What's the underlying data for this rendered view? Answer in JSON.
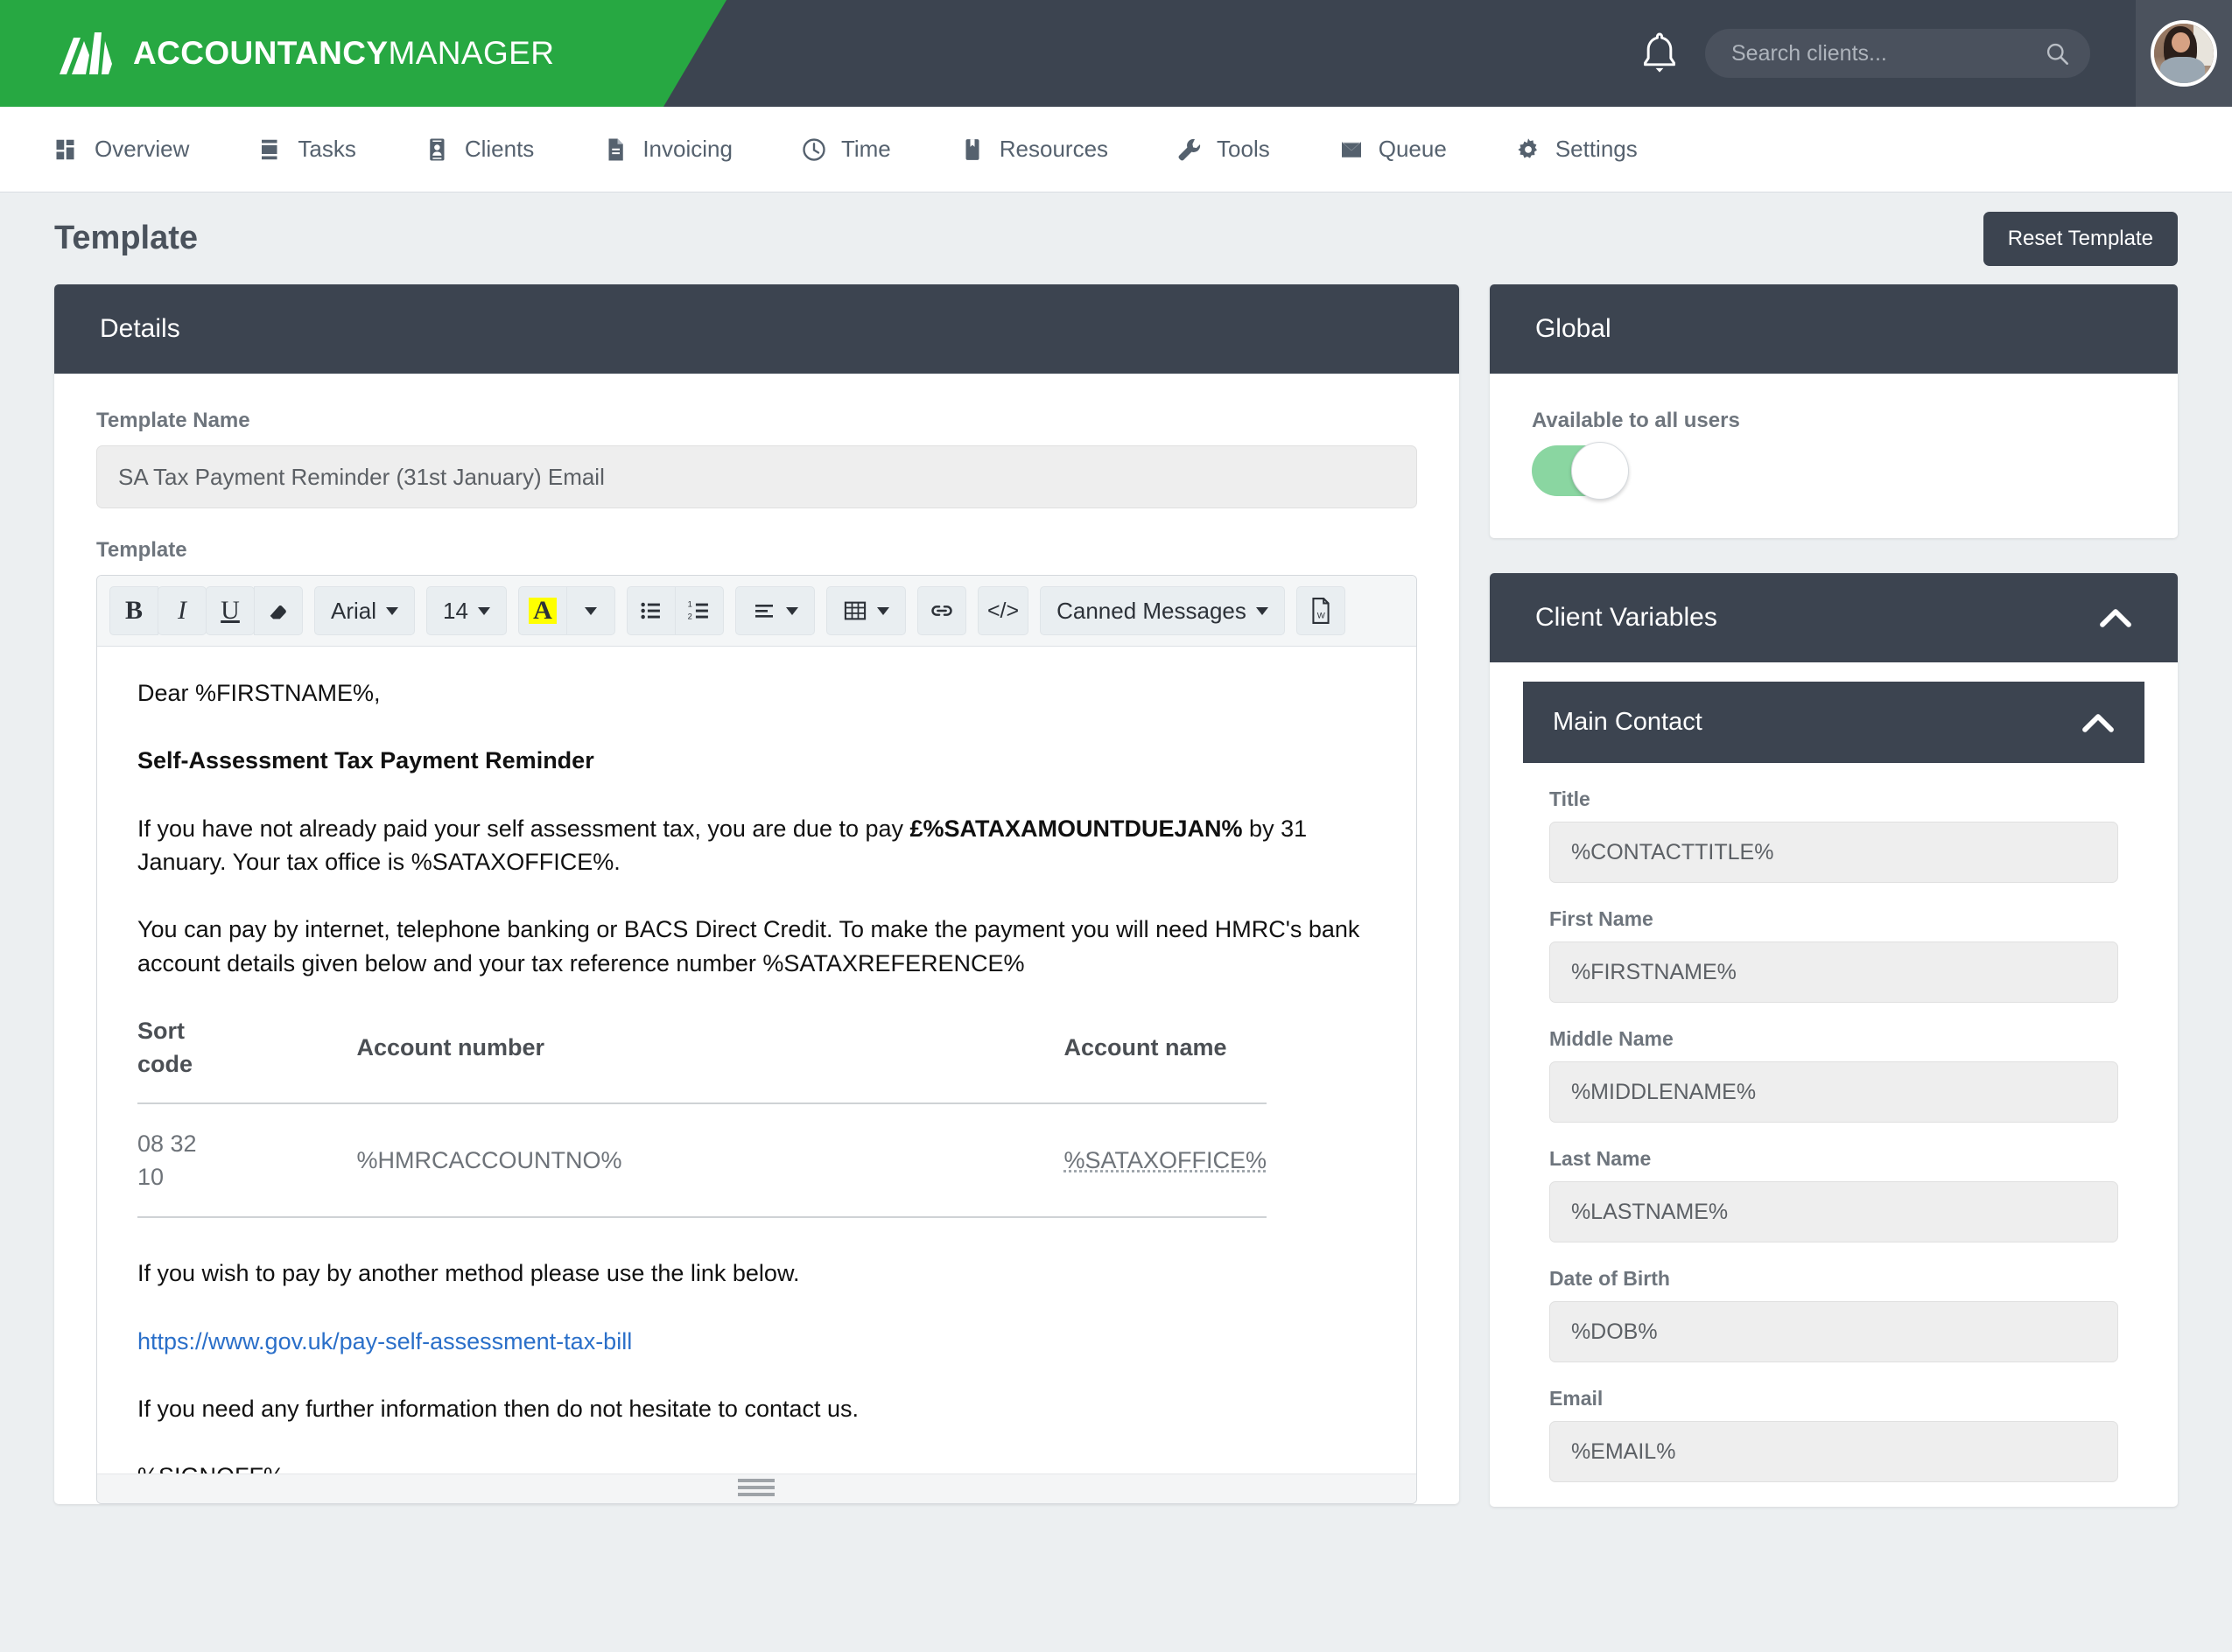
{
  "brand": {
    "name_bold": "ACCOUNTANCY",
    "name_light": "MANAGER",
    "green": "#27a842",
    "dark": "#3c4450"
  },
  "header": {
    "search_placeholder": "Search clients...",
    "search_value": "",
    "bell_icon": "bell-icon",
    "avatar_icon": "avatar"
  },
  "nav": {
    "items": [
      {
        "label": "Overview",
        "icon": "dashboard-grid-icon"
      },
      {
        "label": "Tasks",
        "icon": "list-icon"
      },
      {
        "label": "Clients",
        "icon": "contact-card-icon"
      },
      {
        "label": "Invoicing",
        "icon": "document-icon"
      },
      {
        "label": "Time",
        "icon": "clock-icon"
      },
      {
        "label": "Resources",
        "icon": "book-icon"
      },
      {
        "label": "Tools",
        "icon": "wrench-icon"
      },
      {
        "label": "Queue",
        "icon": "envelope-icon"
      },
      {
        "label": "Settings",
        "icon": "gear-icon"
      }
    ]
  },
  "page": {
    "title": "Template",
    "reset_button": "Reset Template"
  },
  "details": {
    "card_title": "Details",
    "template_name_label": "Template Name",
    "template_name_value": "SA Tax Payment Reminder (31st January) Email",
    "template_label": "Template"
  },
  "toolbar": {
    "bold": "B",
    "italic": "I",
    "underline": "U",
    "eraser_icon": "eraser-icon",
    "font_family": "Arial",
    "font_size": "14",
    "highlight_letter": "A",
    "bullet_list_icon": "bullet-list-icon",
    "numbered_list_icon": "numbered-list-icon",
    "align_icon": "align-left-icon",
    "table_icon": "table-icon",
    "link_icon": "link-icon",
    "code_label": "</>",
    "canned_messages": "Canned Messages",
    "word_icon": "word-document-icon"
  },
  "editor": {
    "greeting": "Dear %FIRSTNAME%,",
    "subject": "Self-Assessment Tax Payment Reminder",
    "para1_a": "If you have not already paid your self assessment tax, you are due to pay ",
    "para1_bold": "£%SATAXAMOUNTDUEJAN%",
    "para1_b": " by 31 January. Your tax office is %SATAXOFFICE%.",
    "para2": "You can pay by internet, telephone banking or BACS Direct Credit. To make the payment you will need HMRC's bank account details given below and your tax reference number %SATAXREFERENCE%",
    "table": {
      "headers": [
        "Sort code",
        "Account number",
        "Account name"
      ],
      "rows": [
        [
          "08 32 10",
          "%HMRCACCOUNTNO%",
          "%SATAXOFFICE%"
        ]
      ]
    },
    "para3": "If you wish to pay by another method please use the link below.",
    "link": "https://www.gov.uk/pay-self-assessment-tax-bill",
    "para4": "If you need any further information then do not hesitate to contact us.",
    "signoff": "%SIGNOFF%"
  },
  "global": {
    "card_title": "Global",
    "available_label": "Available to all users",
    "available_on": true,
    "toggle_color": "#8ad6a1"
  },
  "client_variables": {
    "card_title": "Client Variables",
    "collapse_icon": "chevron-up-icon",
    "main_contact": {
      "title": "Main Contact",
      "collapse_icon": "chevron-up-icon",
      "fields": [
        {
          "label": "Title",
          "value": "%CONTACTTITLE%"
        },
        {
          "label": "First Name",
          "value": "%FIRSTNAME%"
        },
        {
          "label": "Middle Name",
          "value": "%MIDDLENAME%"
        },
        {
          "label": "Last Name",
          "value": "%LASTNAME%"
        },
        {
          "label": "Date of Birth",
          "value": "%DOB%"
        },
        {
          "label": "Email",
          "value": "%EMAIL%"
        }
      ]
    }
  }
}
